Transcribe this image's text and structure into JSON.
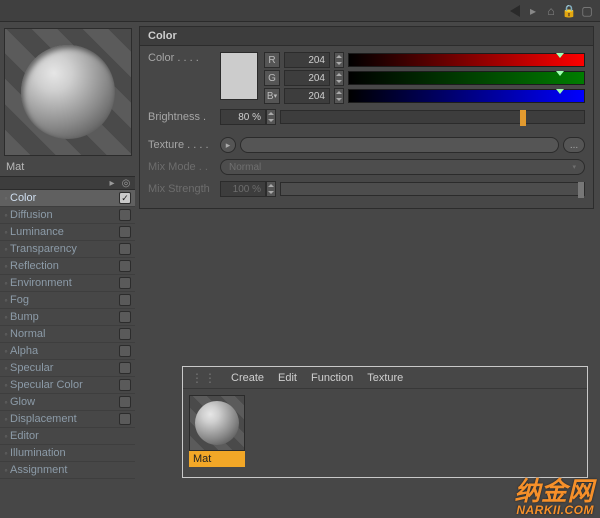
{
  "section_title": "Color",
  "material_name": "Mat",
  "channels": [
    {
      "label": "Color",
      "checked": true,
      "active": true,
      "hasCheck": true
    },
    {
      "label": "Diffusion",
      "checked": false,
      "active": false,
      "hasCheck": true
    },
    {
      "label": "Luminance",
      "checked": false,
      "active": false,
      "hasCheck": true
    },
    {
      "label": "Transparency",
      "checked": false,
      "active": false,
      "hasCheck": true
    },
    {
      "label": "Reflection",
      "checked": false,
      "active": false,
      "hasCheck": true
    },
    {
      "label": "Environment",
      "checked": false,
      "active": false,
      "hasCheck": true
    },
    {
      "label": "Fog",
      "checked": false,
      "active": false,
      "hasCheck": true
    },
    {
      "label": "Bump",
      "checked": false,
      "active": false,
      "hasCheck": true
    },
    {
      "label": "Normal",
      "checked": false,
      "active": false,
      "hasCheck": true
    },
    {
      "label": "Alpha",
      "checked": false,
      "active": false,
      "hasCheck": true
    },
    {
      "label": "Specular",
      "checked": false,
      "active": false,
      "hasCheck": true
    },
    {
      "label": "Specular Color",
      "checked": false,
      "active": false,
      "hasCheck": true
    },
    {
      "label": "Glow",
      "checked": false,
      "active": false,
      "hasCheck": true
    },
    {
      "label": "Displacement",
      "checked": false,
      "active": false,
      "hasCheck": true
    },
    {
      "label": "Editor",
      "checked": false,
      "active": false,
      "hasCheck": false
    },
    {
      "label": "Illumination",
      "checked": false,
      "active": false,
      "hasCheck": false
    },
    {
      "label": "Assignment",
      "checked": false,
      "active": false,
      "hasCheck": false
    }
  ],
  "color": {
    "label": "Color",
    "swatch_hex": "#cccccc",
    "r": {
      "label": "R",
      "value": "204"
    },
    "g": {
      "label": "G",
      "value": "204"
    },
    "b": {
      "label": "B",
      "value": "204"
    }
  },
  "brightness": {
    "label": "Brightness",
    "value": "80 %",
    "pct": 80
  },
  "texture": {
    "label": "Texture",
    "more": "..."
  },
  "mixmode": {
    "label": "Mix Mode",
    "value": "Normal"
  },
  "mixstrength": {
    "label": "Mix Strength",
    "value": "100 %",
    "pct": 100
  },
  "matpanel": {
    "menu": [
      "Create",
      "Edit",
      "Function",
      "Texture"
    ],
    "thumb_label": "Mat"
  },
  "watermark": {
    "big": "纳金网",
    "small": "NARKII.COM"
  }
}
